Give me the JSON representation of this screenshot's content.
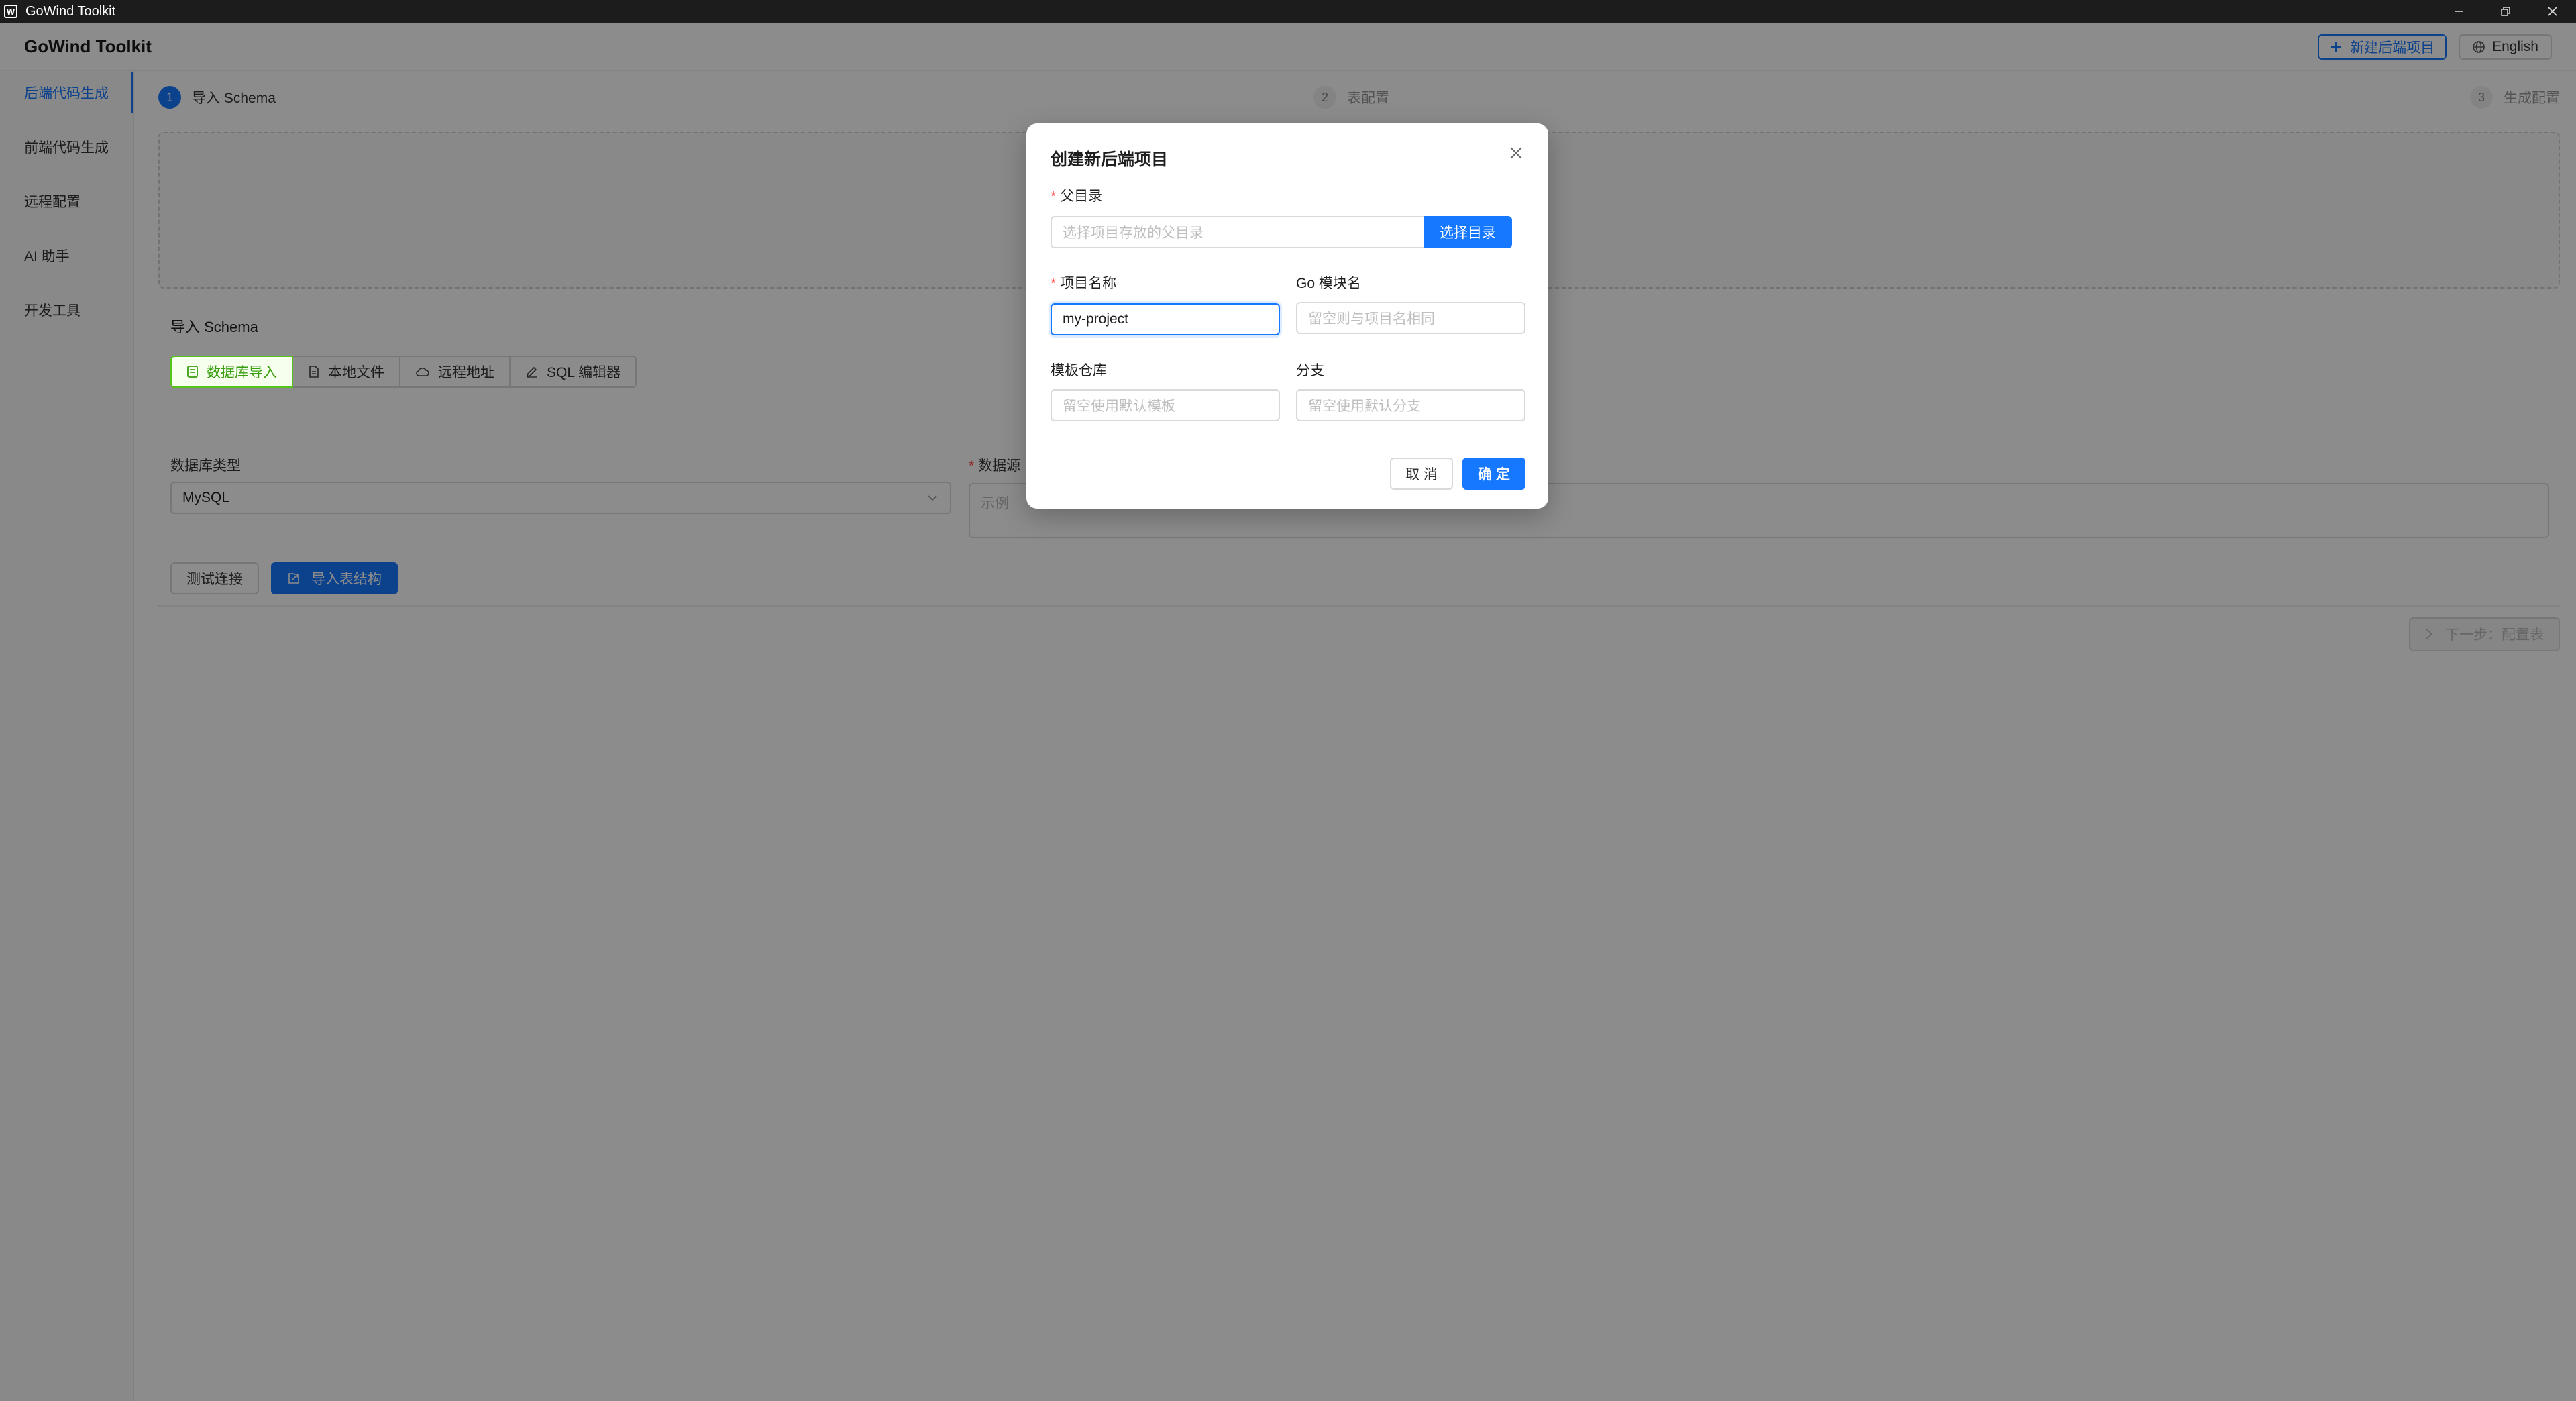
{
  "window": {
    "title": "GoWind Toolkit",
    "icon_text": "W"
  },
  "header": {
    "brand": "GoWind Toolkit",
    "new_project_label": "新建后端项目",
    "language_label": "English"
  },
  "sidebar": {
    "items": [
      {
        "label": "后端代码生成",
        "active": true
      },
      {
        "label": "前端代码生成",
        "active": false
      },
      {
        "label": "远程配置",
        "active": false
      },
      {
        "label": "AI 助手",
        "active": false
      },
      {
        "label": "开发工具",
        "active": false
      }
    ]
  },
  "steps": [
    {
      "num": "1",
      "label": "导入 Schema",
      "state": "active"
    },
    {
      "num": "2",
      "label": "表配置",
      "state": "inactive"
    },
    {
      "num": "3",
      "label": "生成配置",
      "state": "inactive"
    }
  ],
  "import_section": {
    "title": "导入 Schema",
    "tabs": [
      {
        "label": "数据库导入",
        "icon": "database-icon",
        "active": true
      },
      {
        "label": "本地文件",
        "icon": "file-icon",
        "active": false
      },
      {
        "label": "远程地址",
        "icon": "cloud-icon",
        "active": false
      },
      {
        "label": "SQL 编辑器",
        "icon": "edit-icon",
        "active": false
      }
    ],
    "db_type_label": "数据库类型",
    "db_type_value": "MySQL",
    "dsn_label": "数据源",
    "dsn_placeholder": "示例",
    "test_button": "测试连接",
    "import_button": "导入表结构",
    "next_button": "下一步：配置表"
  },
  "modal": {
    "title": "创建新后端项目",
    "parent_dir": {
      "label": "父目录",
      "required": true,
      "placeholder": "选择项目存放的父目录",
      "button": "选择目录"
    },
    "project_name": {
      "label": "项目名称",
      "required": true,
      "value": "my-project"
    },
    "go_module": {
      "label": "Go 模块名",
      "placeholder": "留空则与项目名相同"
    },
    "template_repo": {
      "label": "模板仓库",
      "placeholder": "留空使用默认模板"
    },
    "branch": {
      "label": "分支",
      "placeholder": "留空使用默认分支"
    },
    "cancel_button": "取 消",
    "ok_button": "确 定"
  },
  "colors": {
    "primary": "#1677ff",
    "success": "#52c41a",
    "required": "#ff4d4f",
    "titlebar": "#1c1c1c"
  }
}
